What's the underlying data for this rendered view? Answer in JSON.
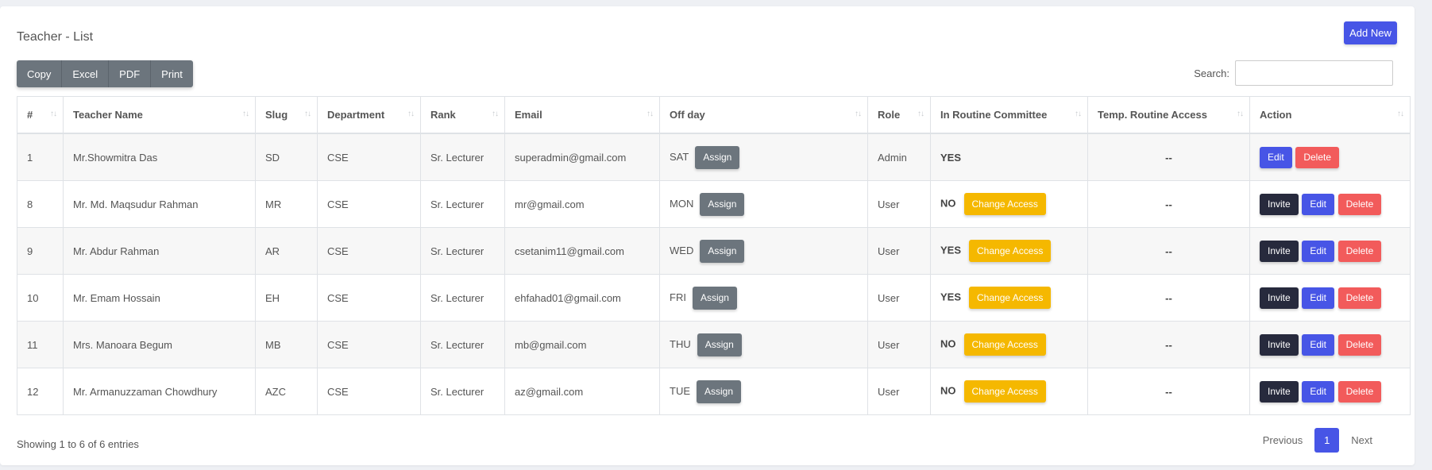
{
  "page": {
    "title": "Teacher - List",
    "add_new_label": "Add New",
    "export_buttons": [
      "Copy",
      "Excel",
      "PDF",
      "Print"
    ],
    "search_label": "Search:",
    "search_value": ""
  },
  "table": {
    "columns": [
      "#",
      "Teacher Name",
      "Slug",
      "Department",
      "Rank",
      "Email",
      "Off day",
      "Role",
      "In Routine Committee",
      "Temp. Routine Access",
      "Action"
    ],
    "assign_label": "Assign",
    "change_access_label": "Change Access",
    "invite_label": "Invite",
    "edit_label": "Edit",
    "delete_label": "Delete",
    "rows": [
      {
        "id": "1",
        "name": "Mr.Showmitra Das",
        "slug": "SD",
        "department": "CSE",
        "rank": "Sr. Lecturer",
        "email": "superadmin@gmail.com",
        "off_day": "SAT",
        "role": "Admin",
        "committee": "YES",
        "temp_access": "--",
        "show_change_access": false,
        "show_invite": false
      },
      {
        "id": "8",
        "name": "Mr. Md. Maqsudur Rahman",
        "slug": "MR",
        "department": "CSE",
        "rank": "Sr. Lecturer",
        "email": "mr@gmail.com",
        "off_day": "MON",
        "role": "User",
        "committee": "NO",
        "temp_access": "--",
        "show_change_access": true,
        "show_invite": true
      },
      {
        "id": "9",
        "name": "Mr. Abdur Rahman",
        "slug": "AR",
        "department": "CSE",
        "rank": "Sr. Lecturer",
        "email": "csetanim11@gmail.com",
        "off_day": "WED",
        "role": "User",
        "committee": "YES",
        "temp_access": "--",
        "show_change_access": true,
        "show_invite": true
      },
      {
        "id": "10",
        "name": "Mr. Emam Hossain",
        "slug": "EH",
        "department": "CSE",
        "rank": "Sr. Lecturer",
        "email": "ehfahad01@gmail.com",
        "off_day": "FRI",
        "role": "User",
        "committee": "YES",
        "temp_access": "--",
        "show_change_access": true,
        "show_invite": true
      },
      {
        "id": "11",
        "name": "Mrs. Manoara Begum",
        "slug": "MB",
        "department": "CSE",
        "rank": "Sr. Lecturer",
        "email": "mb@gmail.com",
        "off_day": "THU",
        "role": "User",
        "committee": "NO",
        "temp_access": "--",
        "show_change_access": true,
        "show_invite": true
      },
      {
        "id": "12",
        "name": "Mr. Armanuzzaman Chowdhury",
        "slug": "AZC",
        "department": "CSE",
        "rank": "Sr. Lecturer",
        "email": "az@gmail.com",
        "off_day": "TUE",
        "role": "User",
        "committee": "NO",
        "temp_access": "--",
        "show_change_access": true,
        "show_invite": true
      }
    ]
  },
  "footer": {
    "info": "Showing 1 to 6 of 6 entries",
    "previous_label": "Previous",
    "current_page": "1",
    "next_label": "Next"
  },
  "colors": {
    "primary": "#4755e6",
    "secondary": "#6c757d",
    "warning": "#f5b800",
    "danger": "#f25b5b",
    "dark": "#272a3d"
  }
}
